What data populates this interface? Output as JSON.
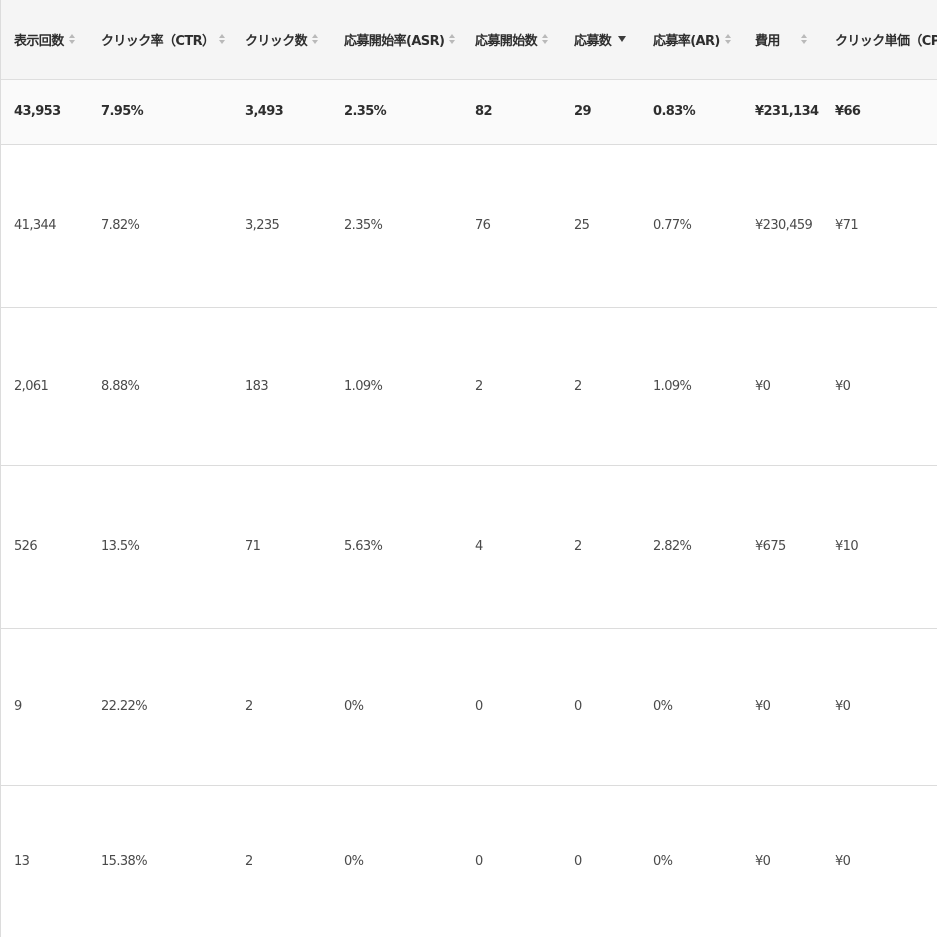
{
  "table": {
    "columns": [
      {
        "label": "表示回数",
        "sort": "both"
      },
      {
        "label": "クリック率（CTR）",
        "sort": "both"
      },
      {
        "label": "クリック数",
        "sort": "both"
      },
      {
        "label": "応募開始率(ASR)",
        "sort": "both"
      },
      {
        "label": "応募開始数",
        "sort": "both"
      },
      {
        "label": "応募数",
        "sort": "desc"
      },
      {
        "label": "応募率(AR)",
        "sort": "both"
      },
      {
        "label": "費用",
        "sort": "both"
      },
      {
        "label": "クリック単価（CPC）",
        "sort": "none"
      }
    ],
    "total": [
      "43,953",
      "7.95%",
      "3,493",
      "2.35%",
      "82",
      "29",
      "0.83%",
      "¥231,134",
      "¥66"
    ],
    "rows": [
      [
        "41,344",
        "7.82%",
        "3,235",
        "2.35%",
        "76",
        "25",
        "0.77%",
        "¥230,459",
        "¥71"
      ],
      [
        "2,061",
        "8.88%",
        "183",
        "1.09%",
        "2",
        "2",
        "1.09%",
        "¥0",
        "¥0"
      ],
      [
        "526",
        "13.5%",
        "71",
        "5.63%",
        "4",
        "2",
        "2.82%",
        "¥675",
        "¥10"
      ],
      [
        "9",
        "22.22%",
        "2",
        "0%",
        "0",
        "0",
        "0%",
        "¥0",
        "¥0"
      ],
      [
        "13",
        "15.38%",
        "2",
        "0%",
        "0",
        "0",
        "0%",
        "¥0",
        "¥0"
      ]
    ]
  },
  "colors": {
    "header_bg": "#f5f5f5",
    "total_bg": "#fafafa",
    "border": "#dcdcdc",
    "text": "#4a4a4a",
    "sort_icon": "#b9b9b9",
    "sort_active": "#3c3c3c"
  },
  "icons": {
    "sort_both": "sort-updown-icon",
    "sort_desc": "sort-down-icon"
  }
}
